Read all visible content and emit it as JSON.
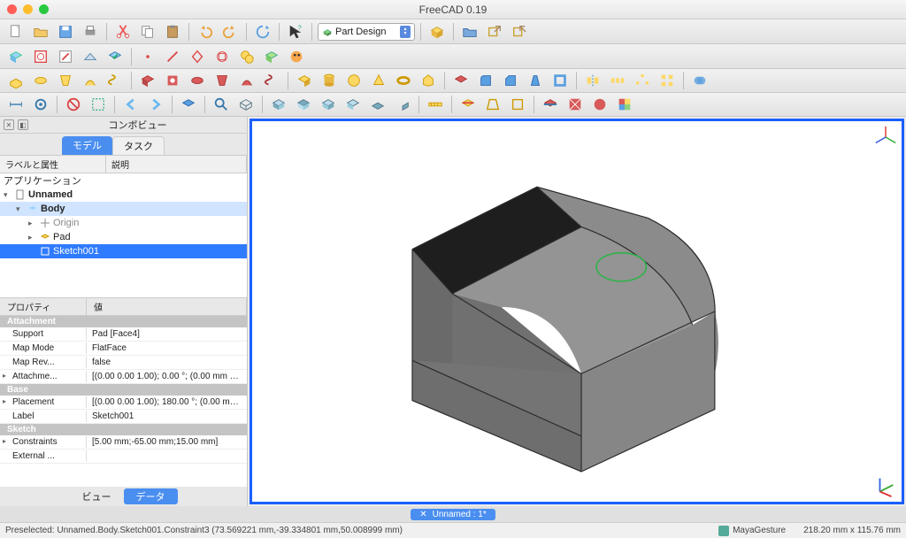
{
  "title": "FreeCAD 0.19",
  "workbench": "Part Design",
  "combo_view": {
    "title": "コンボビュー",
    "tabs": {
      "model": "モデル",
      "task": "タスク"
    },
    "columns": {
      "label": "ラベルと属性",
      "desc": "説明"
    },
    "app_label": "アプリケーション",
    "tree": {
      "doc": "Unnamed",
      "body": "Body",
      "origin": "Origin",
      "pad": "Pad",
      "sketch": "Sketch001"
    }
  },
  "properties": {
    "header": {
      "prop": "プロパティ",
      "val": "値"
    },
    "sections": {
      "attachment": "Attachment",
      "base": "Base",
      "sketch": "Sketch"
    },
    "rows": {
      "support_k": "Support",
      "support_v": "Pad [Face4]",
      "mapmode_k": "Map Mode",
      "mapmode_v": "FlatFace",
      "maprev_k": "Map Rev...",
      "maprev_v": "false",
      "attachoff_k": "Attachme...",
      "attachoff_v": "[(0.00 0.00 1.00); 0.00 °; (0.00 mm  0....",
      "placement_k": "Placement",
      "placement_v": "[(0.00 0.00 1.00); 180.00 °; (0.00 mm ...",
      "label_k": "Label",
      "label_v": "Sketch001",
      "constraints_k": "Constraints",
      "constraints_v": "[5.00 mm;-65.00 mm;15.00 mm]",
      "external_k": "External ...",
      "external_v": ""
    },
    "bottom_tabs": {
      "view": "ビュー",
      "data": "データ"
    }
  },
  "doc_tab": "Unnamed : 1*",
  "status": {
    "preselect": "Preselected: Unnamed.Body.Sketch001.Constraint3 (73.569221 mm,-39.334801 mm,50.008999 mm)",
    "nav": "MayaGesture",
    "dims": "218.20 mm x 115.76 mm"
  }
}
